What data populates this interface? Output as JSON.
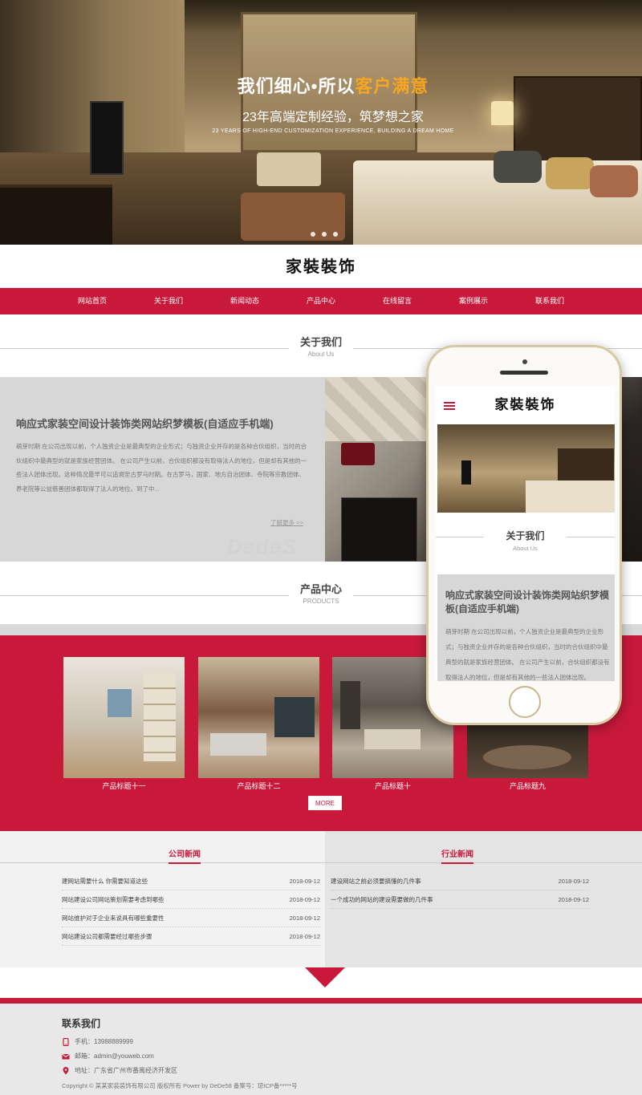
{
  "hero": {
    "title_main": "我们细心•所以",
    "title_highlight": "客户满意",
    "subtitle": "23年高端定制经验，筑梦想之家",
    "subtitle_en": "23 YEARS OF HIGH-END CUSTOMIZATION EXPERIENCE, BUILDING A DREAM HOME",
    "slides": 3
  },
  "site": {
    "logo": "家裝裝饰"
  },
  "nav": {
    "items": [
      "网站首页",
      "关于我们",
      "新闻动态",
      "产品中心",
      "在线留言",
      "案例展示",
      "联系我们"
    ]
  },
  "about": {
    "heading": "关于我们",
    "heading_en": "About Us",
    "title": "响应式家装空间设计装饰类网站织梦模板(自适应手机端)",
    "body": "萌芽时期 在公司出现以前，个人独资企业是最典型的企业形式；与独资企业并存的是各种合伙组织，当时的合伙组织中最典型的就是家族经营团体。 在公司产生以前，合伙组织都没有取得法人的地位，但是却有其他的一些法人团体出现。这种情况最早可以追溯至古罗马时期。在古罗马，国家、地方自治团体、寺院等宗教团体、养老院等公益慈善团体都取得了法人的地位。到了中...",
    "more_link": "了解更多 >>"
  },
  "watermark": "DedeS",
  "products": {
    "heading": "产品中心",
    "heading_en": "PRODUCTS",
    "items": [
      {
        "caption": "产品标题十一"
      },
      {
        "caption": "产品标题十二"
      },
      {
        "caption": "产品标题十"
      },
      {
        "caption": "产品标题九"
      }
    ],
    "more_label": "MORE"
  },
  "news": {
    "company": {
      "tab": "公司新闻",
      "rows": [
        {
          "title": "建网站需要什么 你需要知道这些",
          "date": "2018-09-12"
        },
        {
          "title": "网站建设公司网站策划需要考虑到哪些",
          "date": "2018-09-12"
        },
        {
          "title": "网站维护对于企业来说具有哪些重要性",
          "date": "2018-09-12"
        },
        {
          "title": "网站建设公司都需要经过哪些步骤",
          "date": "2018-09-12"
        }
      ]
    },
    "industry": {
      "tab": "行业新闻",
      "rows": [
        {
          "title": "建设网站之前必须要搞懂的几件事",
          "date": "2018-09-12"
        },
        {
          "title": "一个成功的网站的建设需要做的几件事",
          "date": "2018-09-12"
        }
      ]
    }
  },
  "footer": {
    "title": "联系我们",
    "phone": "手机：13988889999",
    "email": "邮箱：admin@youweb.com",
    "address": "地址：广东省广州市番禺经济开发区",
    "copyright": "Copyright © 某某家装装饰有限公司 版权所有 Power by DeDe58 备案号：琼ICP备*****号"
  },
  "phone": {
    "logo": "家裝裝饰",
    "about_heading": "关于我们",
    "about_heading_en": "About Us",
    "about_title": "响应式家装空间设计装饰类网站织梦模板(自适应手机端)",
    "about_body": "萌芽时期 在公司出现以前，个人独资企业是最典型的企业形式；与独资企业并存的是各种合伙组织，当时的合伙组织中最典型的就是家族经营团体。 在公司产生以前，合伙组织都没有取得法人的地位，但是却有其他的一些法人团体出现。"
  },
  "colors": {
    "brand_red": "#c8193b",
    "hero_highlight": "#f6a623"
  }
}
